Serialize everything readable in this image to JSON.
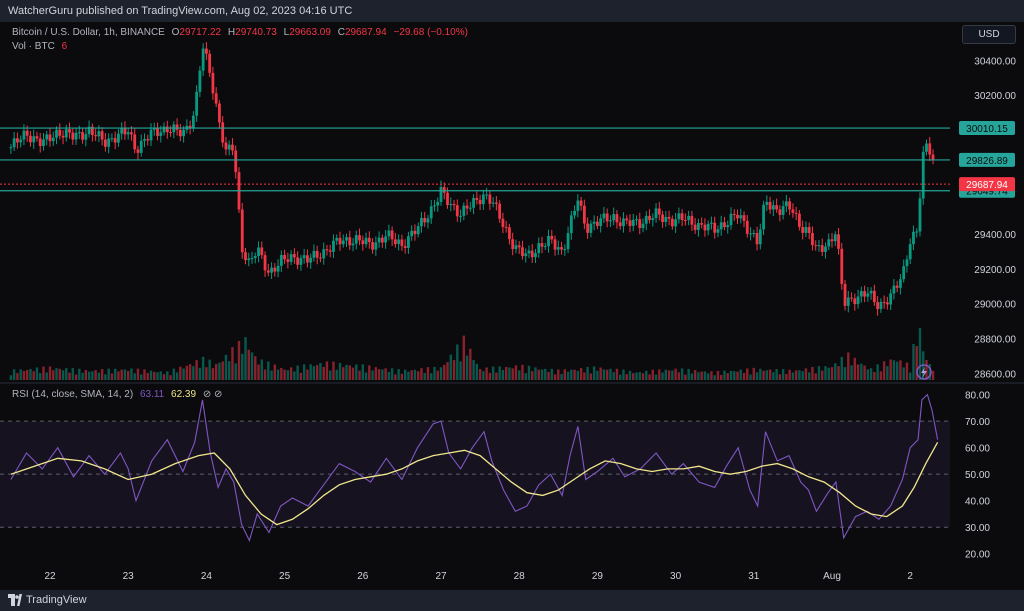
{
  "header": {
    "published_by": "WatcherGuru published on TradingView.com, Aug 02, 2023 04:16 UTC"
  },
  "currency_button": "USD",
  "price_legend": {
    "symbol": "Bitcoin / U.S. Dollar, 1h, BINANCE",
    "open_label": "O",
    "open": "29717.22",
    "high_label": "H",
    "high": "29740.73",
    "low_label": "L",
    "low": "29663.09",
    "close_label": "C",
    "close": "29687.94",
    "change": "−29.68 (−0.10%)",
    "volume_label": "Vol · BTC",
    "volume_value": "6"
  },
  "rsi_legend": {
    "label": "RSI (14, close, SMA, 14, 2)",
    "rsi_value": "63.11",
    "sma_value": "62.39",
    "icons": "⊘  ⊘"
  },
  "footer": {
    "brand": "TradingView"
  },
  "colors": {
    "up": "#089981",
    "down": "#f23645",
    "hline": "#26a69a",
    "rsi": "#7e57c2",
    "rsi_ma": "#f0e68c",
    "background": "#0b0b0e"
  },
  "chart_data": [
    {
      "type": "candlestick",
      "symbol": "Bitcoin / U.S. Dollar",
      "timeframe": "1h",
      "y_axis_ticks": [
        28600,
        28800,
        29000,
        29200,
        29400,
        29600,
        29800,
        30000,
        30200,
        30400
      ],
      "y_axis_labels": [
        "28600.00",
        "28800.00",
        "29000.00",
        "29200.00",
        "29400.00",
        "30200.00",
        "30400.00"
      ],
      "ylim": [
        28550,
        30620
      ],
      "x_tick_labels": [
        "22",
        "23",
        "24",
        "25",
        "26",
        "27",
        "28",
        "29",
        "30",
        "31",
        "Aug",
        "2"
      ],
      "x_tick_days": [
        0,
        1,
        2,
        3,
        4,
        5,
        6,
        7,
        8,
        9,
        10,
        11
      ],
      "horizontal_levels": [
        {
          "value": 30010.15,
          "label": "30010.15",
          "color": "#26a69a"
        },
        {
          "value": 29826.89,
          "label": "29826.89",
          "color": "#26a69a"
        },
        {
          "value": 29649.74,
          "label": "29649.74",
          "color": "#26a69a"
        }
      ],
      "last_price": {
        "value": 29687.94,
        "label": "29687.94"
      },
      "close_path": [
        [
          -0.5,
          29900
        ],
        [
          -0.3,
          29980
        ],
        [
          -0.1,
          29920
        ],
        [
          0.1,
          29990
        ],
        [
          0.3,
          29960
        ],
        [
          0.5,
          29995
        ],
        [
          0.7,
          29930
        ],
        [
          0.9,
          29975
        ],
        [
          1.0,
          29990
        ],
        [
          1.1,
          29890
        ],
        [
          1.3,
          29980
        ],
        [
          1.5,
          30010
        ],
        [
          1.7,
          29975
        ],
        [
          1.85,
          30100
        ],
        [
          1.95,
          30480
        ],
        [
          2.05,
          30320
        ],
        [
          2.15,
          30080
        ],
        [
          2.25,
          29870
        ],
        [
          2.35,
          29900
        ],
        [
          2.45,
          29330
        ],
        [
          2.55,
          29230
        ],
        [
          2.65,
          29310
        ],
        [
          2.8,
          29180
        ],
        [
          2.95,
          29240
        ],
        [
          3.1,
          29270
        ],
        [
          3.3,
          29250
        ],
        [
          3.5,
          29300
        ],
        [
          3.7,
          29360
        ],
        [
          3.9,
          29370
        ],
        [
          4.1,
          29340
        ],
        [
          4.3,
          29390
        ],
        [
          4.5,
          29340
        ],
        [
          4.7,
          29430
        ],
        [
          4.9,
          29560
        ],
        [
          5.0,
          29640
        ],
        [
          5.1,
          29580
        ],
        [
          5.25,
          29520
        ],
        [
          5.4,
          29570
        ],
        [
          5.55,
          29630
        ],
        [
          5.65,
          29590
        ],
        [
          5.8,
          29450
        ],
        [
          5.95,
          29320
        ],
        [
          6.1,
          29270
        ],
        [
          6.25,
          29330
        ],
        [
          6.4,
          29360
        ],
        [
          6.55,
          29300
        ],
        [
          6.65,
          29450
        ],
        [
          6.75,
          29600
        ],
        [
          6.85,
          29440
        ],
        [
          7.0,
          29470
        ],
        [
          7.2,
          29500
        ],
        [
          7.35,
          29460
        ],
        [
          7.55,
          29470
        ],
        [
          7.75,
          29510
        ],
        [
          7.95,
          29480
        ],
        [
          8.1,
          29490
        ],
        [
          8.3,
          29450
        ],
        [
          8.5,
          29430
        ],
        [
          8.65,
          29470
        ],
        [
          8.8,
          29510
        ],
        [
          8.95,
          29420
        ],
        [
          9.05,
          29350
        ],
        [
          9.15,
          29590
        ],
        [
          9.3,
          29540
        ],
        [
          9.45,
          29560
        ],
        [
          9.6,
          29450
        ],
        [
          9.7,
          29410
        ],
        [
          9.8,
          29300
        ],
        [
          9.95,
          29350
        ],
        [
          10.05,
          29420
        ],
        [
          10.15,
          29000
        ],
        [
          10.3,
          29040
        ],
        [
          10.45,
          29060
        ],
        [
          10.6,
          28990
        ],
        [
          10.75,
          29040
        ],
        [
          10.9,
          29160
        ],
        [
          11.0,
          29370
        ],
        [
          11.1,
          29420
        ],
        [
          11.15,
          29820
        ],
        [
          11.22,
          29920
        ],
        [
          11.28,
          29860
        ],
        [
          11.35,
          29690
        ]
      ],
      "volume_path": [
        [
          -0.5,
          6
        ],
        [
          0,
          8
        ],
        [
          0.5,
          6
        ],
        [
          1.0,
          7
        ],
        [
          1.5,
          5
        ],
        [
          2.0,
          14
        ],
        [
          2.1,
          9
        ],
        [
          2.5,
          26
        ],
        [
          2.65,
          13
        ],
        [
          3.0,
          7
        ],
        [
          3.5,
          11
        ],
        [
          4.0,
          9
        ],
        [
          4.5,
          6
        ],
        [
          5.0,
          8
        ],
        [
          5.3,
          26
        ],
        [
          5.5,
          7
        ],
        [
          6.0,
          9
        ],
        [
          6.5,
          6
        ],
        [
          7.0,
          8
        ],
        [
          7.5,
          5
        ],
        [
          8.0,
          7
        ],
        [
          8.5,
          5
        ],
        [
          9.0,
          7
        ],
        [
          9.5,
          6
        ],
        [
          10.0,
          9
        ],
        [
          10.2,
          16
        ],
        [
          10.5,
          7
        ],
        [
          10.8,
          14
        ],
        [
          11.0,
          9
        ],
        [
          11.1,
          37
        ],
        [
          11.2,
          14
        ],
        [
          11.35,
          3
        ]
      ],
      "volume_max": 40
    },
    {
      "type": "line",
      "title": "RSI (14, close, SMA, 14, 2)",
      "y_axis_ticks": [
        20,
        30,
        40,
        50,
        60,
        70,
        80
      ],
      "y_axis_labels": [
        "20.00",
        "30.00",
        "40.00",
        "50.00",
        "60.00",
        "70.00",
        "80.00"
      ],
      "ylim": [
        15,
        84
      ],
      "bands": [
        30,
        50,
        70
      ],
      "series": [
        {
          "color": "#7e57c2",
          "points": [
            [
              -0.5,
              48
            ],
            [
              -0.3,
              58
            ],
            [
              -0.1,
              52
            ],
            [
              0.1,
              60
            ],
            [
              0.3,
              49
            ],
            [
              0.5,
              57
            ],
            [
              0.7,
              50
            ],
            [
              0.9,
              58
            ],
            [
              1.0,
              52
            ],
            [
              1.1,
              40
            ],
            [
              1.3,
              55
            ],
            [
              1.5,
              63
            ],
            [
              1.7,
              51
            ],
            [
              1.85,
              62
            ],
            [
              1.95,
              78
            ],
            [
              2.05,
              58
            ],
            [
              2.15,
              45
            ],
            [
              2.25,
              52
            ],
            [
              2.35,
              47
            ],
            [
              2.45,
              31
            ],
            [
              2.55,
              25
            ],
            [
              2.65,
              35
            ],
            [
              2.8,
              28
            ],
            [
              2.95,
              38
            ],
            [
              3.1,
              41
            ],
            [
              3.3,
              38
            ],
            [
              3.5,
              46
            ],
            [
              3.7,
              54
            ],
            [
              3.9,
              51
            ],
            [
              4.1,
              47
            ],
            [
              4.3,
              56
            ],
            [
              4.5,
              48
            ],
            [
              4.7,
              60
            ],
            [
              4.9,
              69
            ],
            [
              5.0,
              70
            ],
            [
              5.1,
              58
            ],
            [
              5.25,
              52
            ],
            [
              5.4,
              60
            ],
            [
              5.55,
              66
            ],
            [
              5.65,
              55
            ],
            [
              5.8,
              44
            ],
            [
              5.95,
              36
            ],
            [
              6.1,
              38
            ],
            [
              6.25,
              46
            ],
            [
              6.4,
              50
            ],
            [
              6.55,
              42
            ],
            [
              6.65,
              57
            ],
            [
              6.75,
              68
            ],
            [
              6.85,
              48
            ],
            [
              7.0,
              51
            ],
            [
              7.2,
              56
            ],
            [
              7.35,
              49
            ],
            [
              7.55,
              52
            ],
            [
              7.75,
              58
            ],
            [
              7.95,
              50
            ],
            [
              8.1,
              54
            ],
            [
              8.3,
              47
            ],
            [
              8.5,
              45
            ],
            [
              8.65,
              53
            ],
            [
              8.8,
              60
            ],
            [
              8.95,
              44
            ],
            [
              9.05,
              38
            ],
            [
              9.15,
              66
            ],
            [
              9.3,
              55
            ],
            [
              9.45,
              57
            ],
            [
              9.6,
              47
            ],
            [
              9.7,
              44
            ],
            [
              9.8,
              36
            ],
            [
              9.95,
              43
            ],
            [
              10.05,
              47
            ],
            [
              10.15,
              26
            ],
            [
              10.3,
              34
            ],
            [
              10.45,
              36
            ],
            [
              10.6,
              33
            ],
            [
              10.75,
              38
            ],
            [
              10.9,
              48
            ],
            [
              11.0,
              60
            ],
            [
              11.1,
              63
            ],
            [
              11.15,
              78
            ],
            [
              11.22,
              80
            ],
            [
              11.28,
              74
            ],
            [
              11.35,
              63
            ]
          ]
        },
        {
          "color": "#f0e68c",
          "points": [
            [
              -0.5,
              50
            ],
            [
              -0.2,
              53
            ],
            [
              0.1,
              56
            ],
            [
              0.4,
              55
            ],
            [
              0.7,
              52
            ],
            [
              1.0,
              48
            ],
            [
              1.3,
              50
            ],
            [
              1.6,
              54
            ],
            [
              1.9,
              57
            ],
            [
              2.1,
              58
            ],
            [
              2.3,
              52
            ],
            [
              2.5,
              42
            ],
            [
              2.7,
              35
            ],
            [
              2.9,
              31
            ],
            [
              3.1,
              33
            ],
            [
              3.3,
              37
            ],
            [
              3.5,
              42
            ],
            [
              3.7,
              46
            ],
            [
              3.9,
              48
            ],
            [
              4.1,
              49
            ],
            [
              4.3,
              50
            ],
            [
              4.5,
              52
            ],
            [
              4.7,
              55
            ],
            [
              4.9,
              57
            ],
            [
              5.1,
              58
            ],
            [
              5.3,
              59
            ],
            [
              5.5,
              57
            ],
            [
              5.7,
              52
            ],
            [
              5.9,
              47
            ],
            [
              6.1,
              43
            ],
            [
              6.3,
              42
            ],
            [
              6.5,
              44
            ],
            [
              6.7,
              48
            ],
            [
              6.9,
              52
            ],
            [
              7.1,
              55
            ],
            [
              7.3,
              54
            ],
            [
              7.5,
              52
            ],
            [
              7.7,
              51
            ],
            [
              7.9,
              52
            ],
            [
              8.1,
              52
            ],
            [
              8.3,
              53
            ],
            [
              8.5,
              51
            ],
            [
              8.7,
              50
            ],
            [
              8.9,
              51
            ],
            [
              9.1,
              53
            ],
            [
              9.3,
              54
            ],
            [
              9.5,
              52
            ],
            [
              9.7,
              49
            ],
            [
              9.9,
              47
            ],
            [
              10.1,
              43
            ],
            [
              10.3,
              38
            ],
            [
              10.5,
              35
            ],
            [
              10.7,
              34
            ],
            [
              10.9,
              38
            ],
            [
              11.05,
              45
            ],
            [
              11.2,
              54
            ],
            [
              11.35,
              62
            ]
          ]
        }
      ],
      "x_tick_labels": [
        "22",
        "23",
        "24",
        "25",
        "26",
        "27",
        "28",
        "29",
        "30",
        "31",
        "Aug",
        "2"
      ]
    }
  ]
}
